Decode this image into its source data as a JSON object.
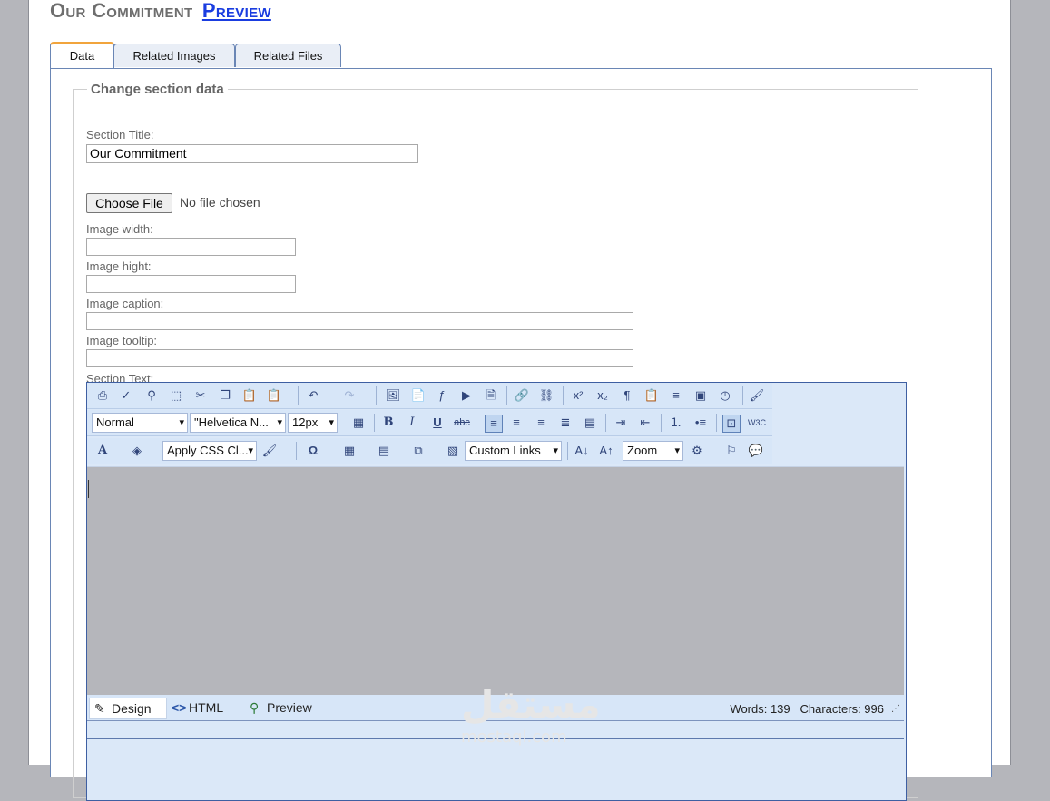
{
  "header": {
    "title": "Our Commitment",
    "preview_link": "Preview"
  },
  "tabs": [
    {
      "label": "Data"
    },
    {
      "label": "Related Images"
    },
    {
      "label": "Related Files"
    }
  ],
  "form": {
    "legend": "Change section data",
    "section_title_label": "Section Title:",
    "section_title_value": "Our Commitment",
    "choose_file_label": "Choose File",
    "no_file_text": "No file chosen",
    "image_width_label": "Image width:",
    "image_hight_label": "Image hight:",
    "image_caption_label": "Image caption:",
    "image_tooltip_label": "Image tooltip:",
    "section_text_label": "Section Text:"
  },
  "editor": {
    "paragraph_style": "Normal",
    "font_name": "\"Helvetica N...",
    "font_size": "12px",
    "css_class": "Apply CSS Cl...",
    "custom_links": "Custom Links",
    "zoom": "Zoom",
    "modes": {
      "design": "Design",
      "html": "HTML",
      "preview": "Preview"
    },
    "words": "Words: 139",
    "characters": "Characters: 996"
  },
  "watermark": {
    "arabic": "مستقل",
    "latin": "mostaql.com"
  }
}
